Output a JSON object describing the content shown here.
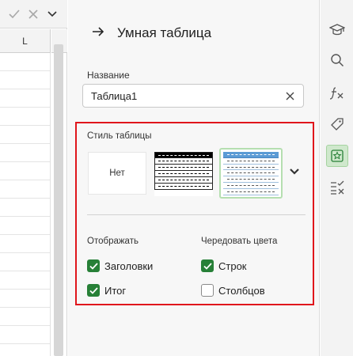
{
  "sheet": {
    "column_label": "L"
  },
  "panel": {
    "title": "Умная таблица",
    "name_label": "Название",
    "name_value": "Таблица1",
    "style_label": "Стиль таблицы",
    "styles": [
      {
        "label": "Нет",
        "selected": false
      },
      {
        "name": "dark-style",
        "selected": false
      },
      {
        "name": "blue-style",
        "selected": true
      }
    ],
    "display_label": "Отображать",
    "alternate_label": "Чередовать цвета",
    "options": {
      "headers": {
        "label": "Заголовки",
        "checked": true
      },
      "total": {
        "label": "Итог",
        "checked": true
      },
      "rows": {
        "label": "Строк",
        "checked": true
      },
      "columns": {
        "label": "Столбцов",
        "checked": false
      }
    }
  },
  "toolbar": {
    "icons": [
      "graduation-cap-icon",
      "search-icon",
      "fx-icon",
      "tag-icon",
      "star-box-icon",
      "check-x-list-icon"
    ],
    "active": "star-box-icon"
  },
  "colors": {
    "accent_green": "#278037",
    "highlight_red": "#e0161c",
    "active_bg": "#cfe8cc"
  }
}
